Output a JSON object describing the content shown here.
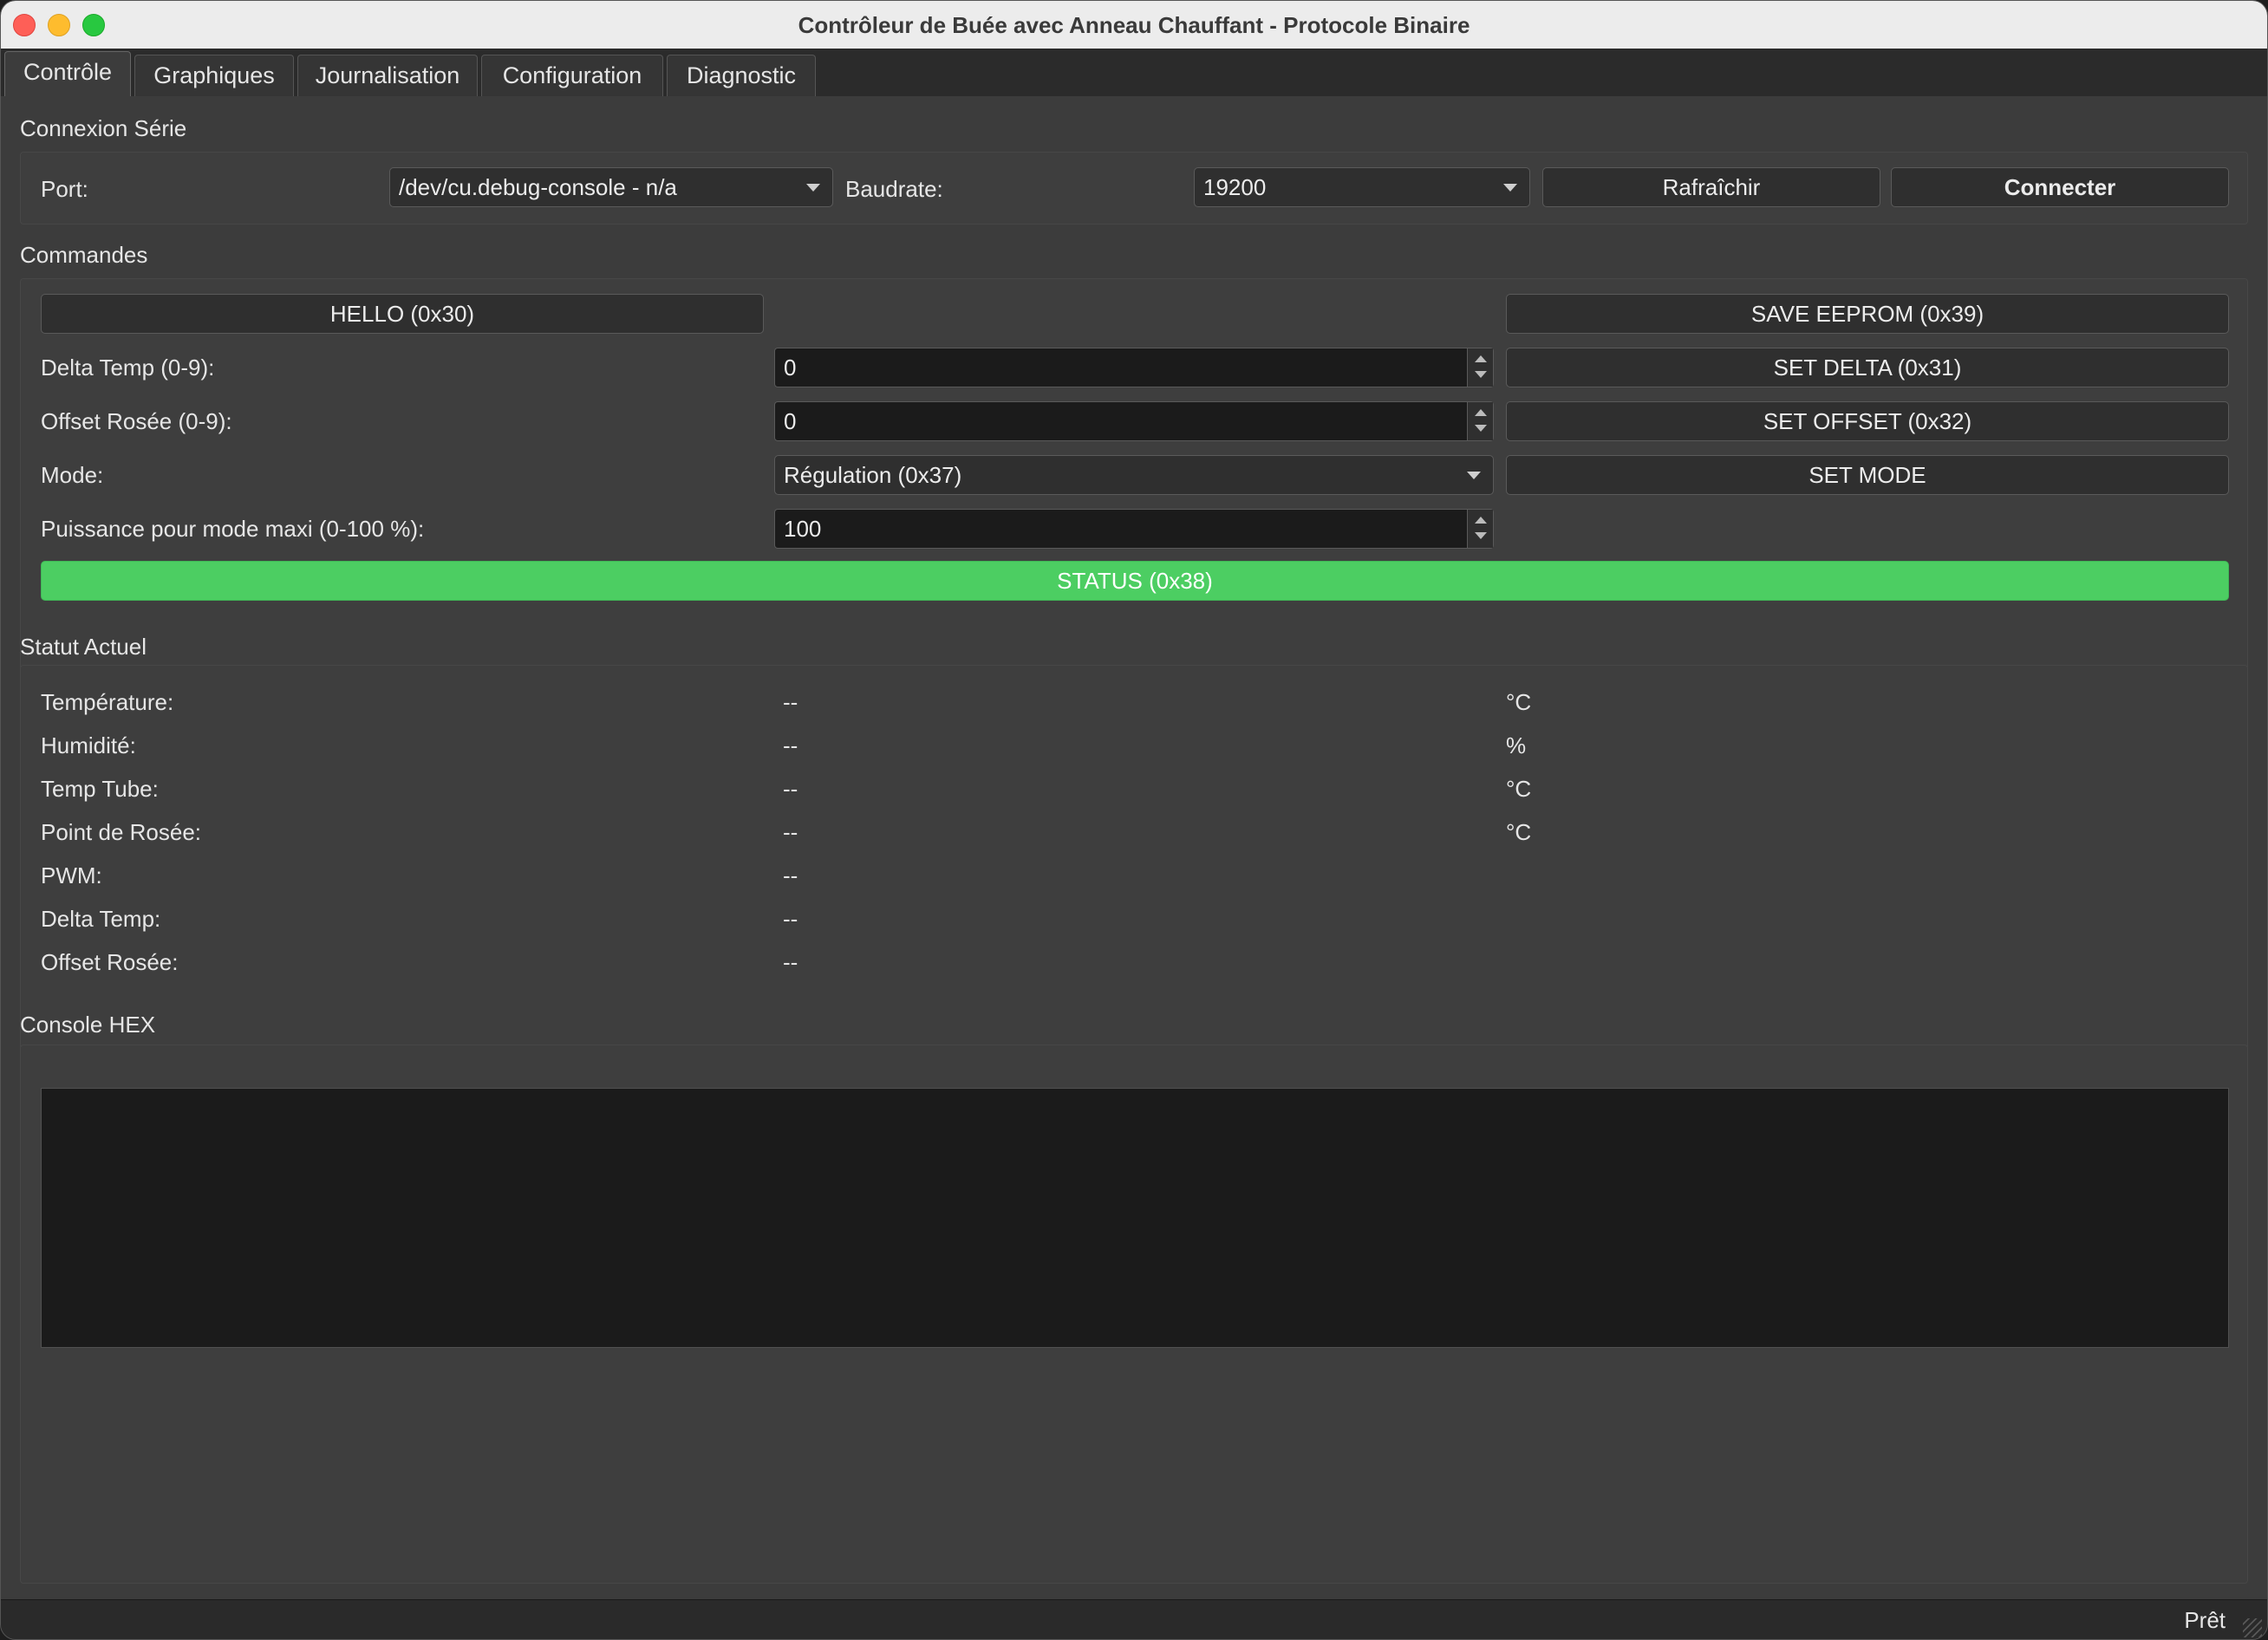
{
  "window": {
    "title": "Contrôleur de Buée avec Anneau Chauffant - Protocole Binaire"
  },
  "tabs": [
    {
      "label": "Contrôle",
      "active": true
    },
    {
      "label": "Graphiques",
      "active": false
    },
    {
      "label": "Journalisation",
      "active": false
    },
    {
      "label": "Configuration",
      "active": false
    },
    {
      "label": "Diagnostic",
      "active": false
    }
  ],
  "serial": {
    "group_title": "Connexion Série",
    "port_label": "Port:",
    "port_value": "/dev/cu.debug-console - n/a",
    "baud_label": "Baudrate:",
    "baud_value": "19200",
    "refresh_label": "Rafraîchir",
    "connect_label": "Connecter"
  },
  "commands": {
    "group_title": "Commandes",
    "hello_label": "HELLO (0x30)",
    "save_eeprom_label": "SAVE EEPROM (0x39)",
    "delta_label": "Delta Temp (0-9):",
    "delta_value": "0",
    "set_delta_label": "SET DELTA (0x31)",
    "offset_label": "Offset Rosée (0-9):",
    "offset_value": "0",
    "set_offset_label": "SET OFFSET (0x32)",
    "mode_label": "Mode:",
    "mode_value": "Régulation (0x37)",
    "set_mode_label": "SET MODE",
    "power_label": "Puissance pour mode maxi (0-100 %):",
    "power_value": "100",
    "status_label": "STATUS (0x38)"
  },
  "status": {
    "group_title": "Statut Actuel",
    "rows": [
      {
        "label": "Température:",
        "value": "--",
        "unit": "°C"
      },
      {
        "label": "Humidité:",
        "value": "--",
        "unit": "%"
      },
      {
        "label": "Temp Tube:",
        "value": "--",
        "unit": "°C"
      },
      {
        "label": "Point de Rosée:",
        "value": "--",
        "unit": "°C"
      },
      {
        "label": "PWM:",
        "value": "--",
        "unit": ""
      },
      {
        "label": "Delta Temp:",
        "value": "--",
        "unit": ""
      },
      {
        "label": "Offset Rosée:",
        "value": "--",
        "unit": ""
      }
    ]
  },
  "console": {
    "group_title": "Console HEX",
    "content": ""
  },
  "statusbar": {
    "text": "Prêt"
  },
  "colors": {
    "status_button": "#4cce62",
    "window_bg": "#3c3c3c",
    "input_bg": "#1b1b1b"
  }
}
